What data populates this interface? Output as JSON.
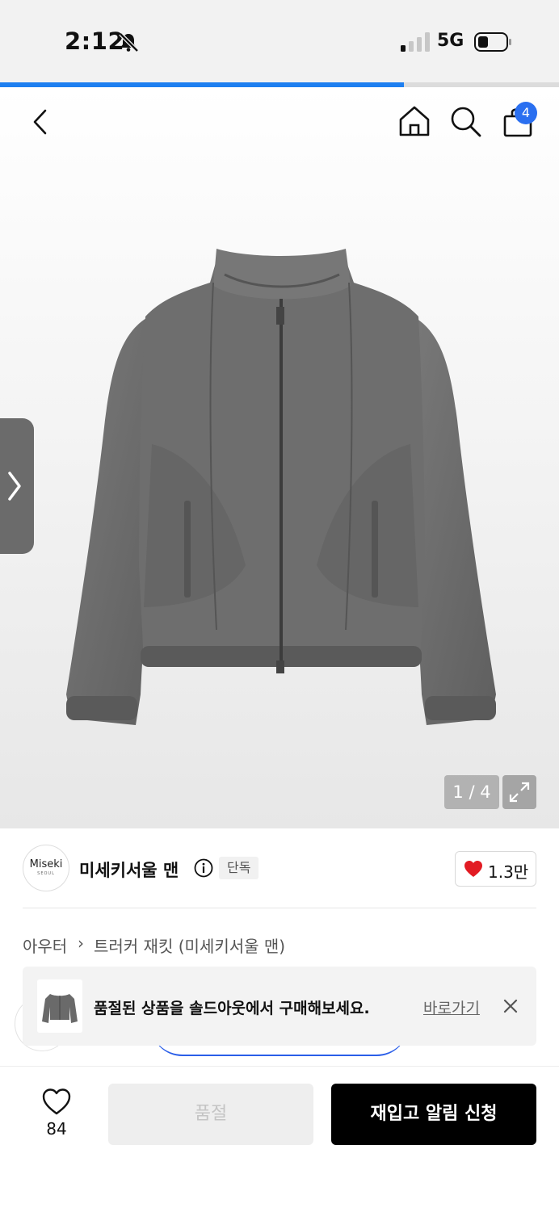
{
  "status_bar": {
    "time": "2:12",
    "network": "5G"
  },
  "gallery": {
    "pager": "1 / 4",
    "current_index": 1,
    "total": 4
  },
  "header": {
    "cart_count": "4"
  },
  "brand": {
    "logo_text": "Miseki",
    "logo_subtext": "SEOUL",
    "name": "미세키서울 맨",
    "exclusive_badge": "단독",
    "likes": "1.3만"
  },
  "breadcrumb": {
    "category": "아우터",
    "separator": "›",
    "product": "트러커 재킷 (미세키서울 맨)"
  },
  "toast": {
    "message": "품절된 상품을 솔드아웃에서 구매해보세요.",
    "link": "바로가기"
  },
  "bottom_bar": {
    "wish_count": "84",
    "soldout_label": "품절",
    "restock_label": "재입고 알림 신청"
  },
  "colors": {
    "accent": "#1e7ff0",
    "badge": "#2a6ff0",
    "heart": "#e21b23",
    "primary_button": "#000000"
  }
}
